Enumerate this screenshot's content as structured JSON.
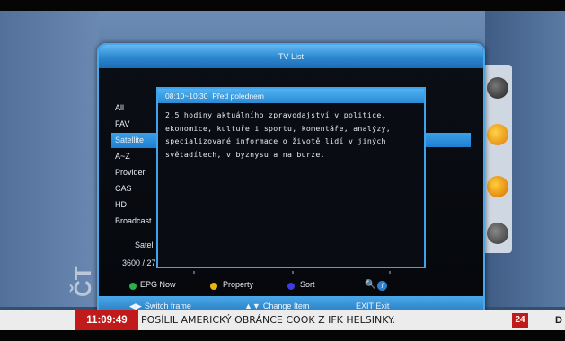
{
  "dialog": {
    "title": "TV List"
  },
  "categories": [
    {
      "label": "All"
    },
    {
      "label": "FAV"
    },
    {
      "label": "Satellite"
    },
    {
      "label": "A~Z"
    },
    {
      "label": "Provider"
    },
    {
      "label": "CAS"
    },
    {
      "label": "HD"
    },
    {
      "label": "Broadcast"
    }
  ],
  "selected_category": "Satellite",
  "satellite_label": "Satel",
  "channel_count": "3600 / 27",
  "epg": {
    "time": "08:10~10:30",
    "title": "Před polednem",
    "description_lines": [
      "  2,5 hodiny aktuálního zpravodajství v politice,",
      "ekonomice, kultuře i sportu, komentáře, analýzy,",
      "specializované informace o životě lidí v jiných",
      "světadílech, v byznysu a na burze."
    ]
  },
  "legend": {
    "epg_now": "EPG Now",
    "property": "Property",
    "sort": "Sort",
    "colors": {
      "green": "#27b24a",
      "yellow": "#e8b414",
      "blue": "#3c3ce0"
    },
    "icons": [
      "search-icon",
      "info-icon"
    ]
  },
  "navbar": {
    "switch_frame": "Switch frame",
    "change_item": "Change Item",
    "exit_key": "EXIT",
    "exit_label": "Exit"
  },
  "ticker": {
    "time": "11:09:49",
    "headline": "POSÍLIL AMERICKÝ OBRÁNCE COOK Z IFK HELSINKY.",
    "channel_logo": "24",
    "trailing": "D"
  },
  "colors": {
    "accent": "#3ea3ea",
    "ticker_red": "#c11a1a"
  }
}
